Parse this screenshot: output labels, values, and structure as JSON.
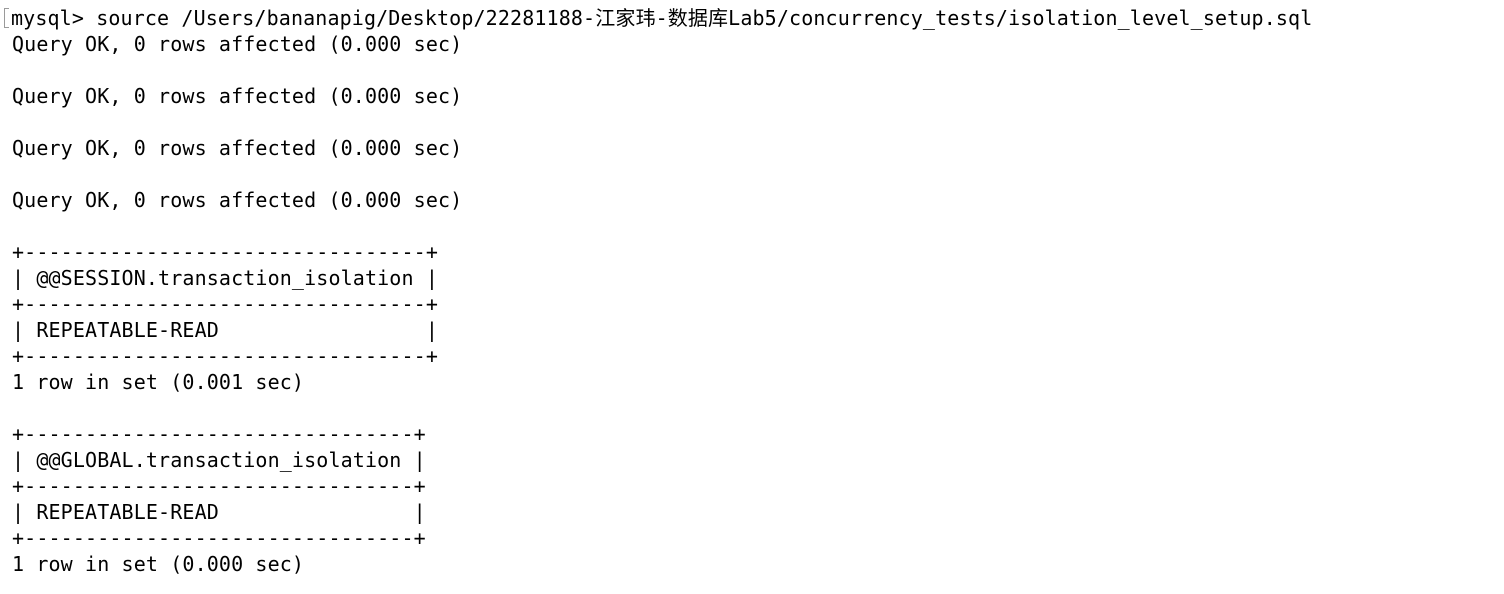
{
  "terminal": {
    "prompt": "mysql> ",
    "command": "source /Users/bananapig/Desktop/22281188-江家玮-数据库Lab5/concurrency_tests/isolation_level_setup.sql",
    "lines": [
      "Query OK, 0 rows affected (0.000 sec)",
      "",
      "Query OK, 0 rows affected (0.000 sec)",
      "",
      "Query OK, 0 rows affected (0.000 sec)",
      "",
      "Query OK, 0 rows affected (0.000 sec)",
      "",
      "+---------------------------------+",
      "| @@SESSION.transaction_isolation |",
      "+---------------------------------+",
      "| REPEATABLE-READ                 |",
      "+---------------------------------+",
      "1 row in set (0.001 sec)",
      "",
      "+--------------------------------+",
      "| @@GLOBAL.transaction_isolation |",
      "+--------------------------------+",
      "| REPEATABLE-READ                |",
      "+--------------------------------+",
      "1 row in set (0.000 sec)"
    ]
  }
}
